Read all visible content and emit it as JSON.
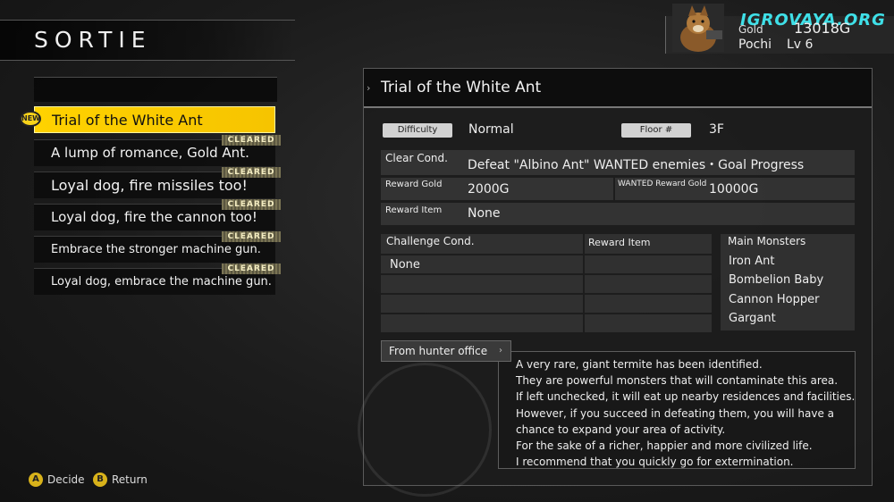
{
  "screen_title": "SORTIE",
  "watermark": "IGROVAYA.ORG",
  "player": {
    "gold_label": "Gold",
    "gold_value": "13018G",
    "pet_name": "Pochi",
    "pet_level": "Lv 6"
  },
  "missions": [
    {
      "label": "Trial of the White Ant",
      "badge": "NEW",
      "cleared": "",
      "active": true
    },
    {
      "label": "A lump of romance, Gold Ant.",
      "badge": "",
      "cleared": "CLEARED",
      "active": false
    },
    {
      "label": "Loyal dog, fire missiles too!",
      "badge": "",
      "cleared": "CLEARED",
      "active": false
    },
    {
      "label": "Loyal dog, fire the cannon too!",
      "badge": "",
      "cleared": "CLEARED",
      "active": false
    },
    {
      "label": "Embrace the stronger machine gun.",
      "badge": "",
      "cleared": "CLEARED",
      "active": false
    },
    {
      "label": "Loyal dog, embrace the machine gun.",
      "badge": "",
      "cleared": "CLEARED",
      "active": false
    }
  ],
  "controls": {
    "decide_key": "A",
    "decide_label": "Decide",
    "return_key": "B",
    "return_label": "Return"
  },
  "detail": {
    "title": "Trial of the White Ant",
    "difficulty_label": "Difficulty",
    "difficulty_value": "Normal",
    "floor_label": "Floor #",
    "floor_value": "3F",
    "clear_cond_label": "Clear Cond.",
    "clear_cond_value": "Defeat \"Albino Ant\" WANTED enemies・Goal Progress",
    "reward_gold_label": "Reward Gold",
    "reward_gold_value": "2000G",
    "wanted_reward_label": "WANTED Reward Gold",
    "wanted_reward_value": "10000G",
    "reward_item_label": "Reward Item",
    "reward_item_value": "None",
    "challenge_cond_label": "Challenge Cond.",
    "challenge_reward_label": "Reward Item",
    "challenge_cond_value": "None",
    "monsters_label": "Main Monsters",
    "monsters": [
      "Iron Ant",
      "Bombelion Baby",
      "Cannon Hopper",
      "Gargant"
    ],
    "office_label": "From hunter office",
    "description": [
      "A very rare, giant termite has been identified.",
      "They are powerful monsters that will contaminate this area.",
      "If left unchecked, it will eat up nearby residences and facilities.",
      "However, if you succeed in defeating them, you will have a",
      "chance to expand your area of activity.",
      "For the sake of a richer, happier and more civilized life.",
      "I recommend that you quickly go for extermination."
    ]
  },
  "colors": {
    "accent_yellow": "#ffd200",
    "watermark_cyan": "#3fe0e8"
  }
}
